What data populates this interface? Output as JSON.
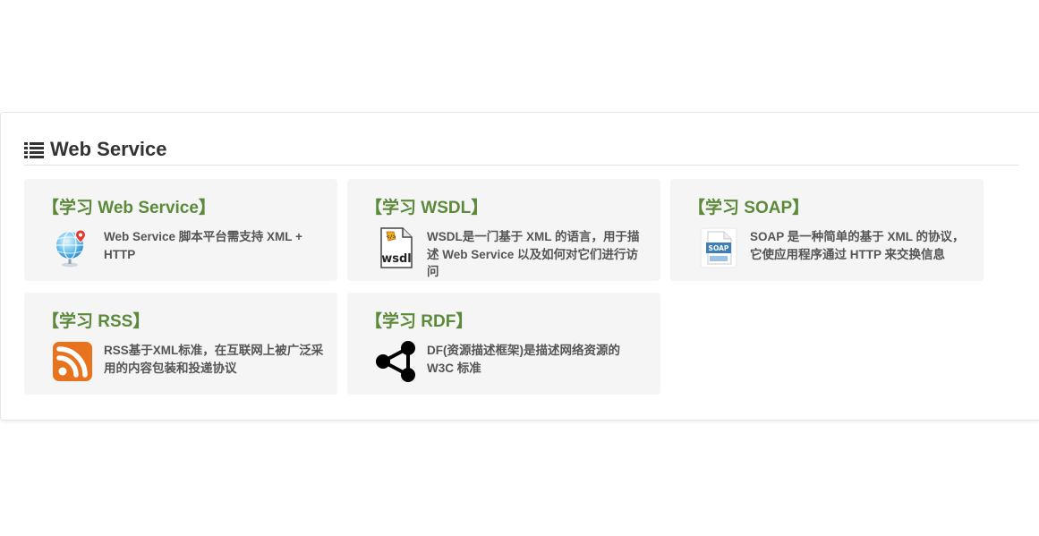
{
  "section": {
    "title": "Web Service"
  },
  "cards": [
    {
      "title": "【学习 Web Service】",
      "desc": "Web Service 脚本平台需支持 XML + HTTP",
      "icon": "globe-pin-icon"
    },
    {
      "title": "【学习 WSDL】",
      "desc": "WSDL是一门基于 XML 的语言，用于描述 Web Service 以及如何对它们进行访问",
      "icon": "wsdl-file-icon"
    },
    {
      "title": "【学习 SOAP】",
      "desc": "SOAP 是一种简单的基于 XML 的协议，它使应用程序通过 HTTP 来交换信息",
      "icon": "soap-file-icon"
    },
    {
      "title": "【学习 RSS】",
      "desc": "RSS基于XML标准，在互联网上被广泛采用的内容包装和投递协议",
      "icon": "rss-icon"
    },
    {
      "title": "【学习 RDF】",
      "desc": "DF(资源描述框架)是描述网络资源的 W3C 标准",
      "icon": "share-nodes-icon"
    }
  ],
  "colors": {
    "title_green": "#5b8a3a",
    "card_bg": "#f5f5f5",
    "rss_orange": "#e8731e"
  },
  "icon_labels": {
    "wsdl": "wsdl",
    "soap": "SOAP"
  }
}
